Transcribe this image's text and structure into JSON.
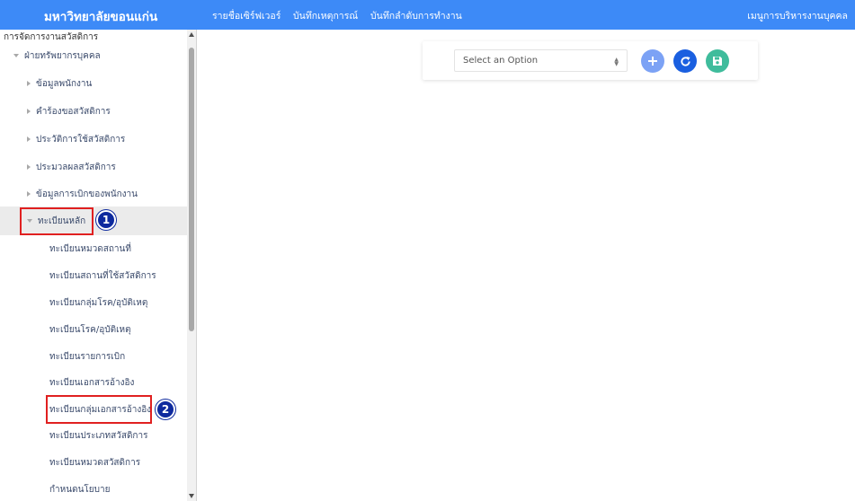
{
  "header": {
    "brand": "มหาวิทยาลัยขอนแก่น",
    "nav": [
      "รายชื่อเซิร์ฟเวอร์",
      "บันทึกเหตุการณ์",
      "บันทึกลำดับการทำงาน"
    ],
    "menu": "เมนูการบริหารงานบุคคล",
    "color": "#3d8af7"
  },
  "sidebar": {
    "root": "การจัดการงานสวัสดิการ",
    "group": "ฝ่ายทรัพยากรบุคคล",
    "items": [
      "ข้อมูลพนักงาน",
      "คำร้องขอสวัสดิการ",
      "ประวัติการใช้สวัสดิการ",
      "ประมวลผลสวัสดิการ",
      "ข้อมูลการเบิกของพนักงาน"
    ],
    "registry": "ทะเบียนหลัก",
    "registry_items": [
      "ทะเบียนหมวดสถานที่",
      "ทะเบียนสถานที่ใช้สวัสดิการ",
      "ทะเบียนกลุ่มโรค/อุบัติเหตุ",
      "ทะเบียนโรค/อุบัติเหตุ",
      "ทะเบียนรายการเบิก",
      "ทะเบียนเอกสารอ้างอิง",
      "ทะเบียนกลุ่มเอกสารอ้างอิง",
      "ทะเบียนประเภทสวัสดิการ",
      "ทะเบียนหมวดสวัสดิการ",
      "กำหนดนโยบาย"
    ]
  },
  "callouts": [
    "1",
    "2"
  ],
  "toolbar": {
    "select_value": "Select an Option",
    "add_icon": "plus-icon",
    "refresh_icon": "refresh-icon",
    "save_icon": "floppy-disk-icon",
    "add_color": "#7ca2f5",
    "refresh_color": "#1a5fe0",
    "save_color": "#3fbc9c"
  }
}
